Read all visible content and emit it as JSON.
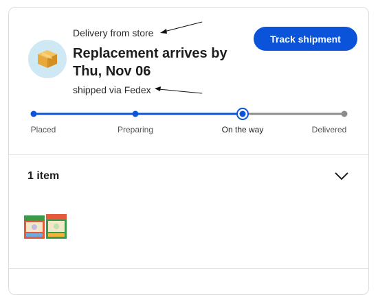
{
  "order": {
    "delivery_label": "Delivery from store",
    "title": "Replacement arrives by Thu, Nov 06",
    "shipped_label": "shipped via Fedex",
    "track_button_label": "Track shipment"
  },
  "progress": {
    "steps": [
      {
        "label": "Placed",
        "state": "done"
      },
      {
        "label": "Preparing",
        "state": "done"
      },
      {
        "label": "On the way",
        "state": "current"
      },
      {
        "label": "Delivered",
        "state": "pending"
      }
    ],
    "active_color": "#0b54d9",
    "inactive_color": "#8c8c8c"
  },
  "items": {
    "count_label": "1 item",
    "expand_icon": "chevron-down-icon"
  },
  "colors": {
    "accent": "#0b54d9",
    "avatar_bg": "#cfe9f4",
    "box": "#e8a93a"
  }
}
